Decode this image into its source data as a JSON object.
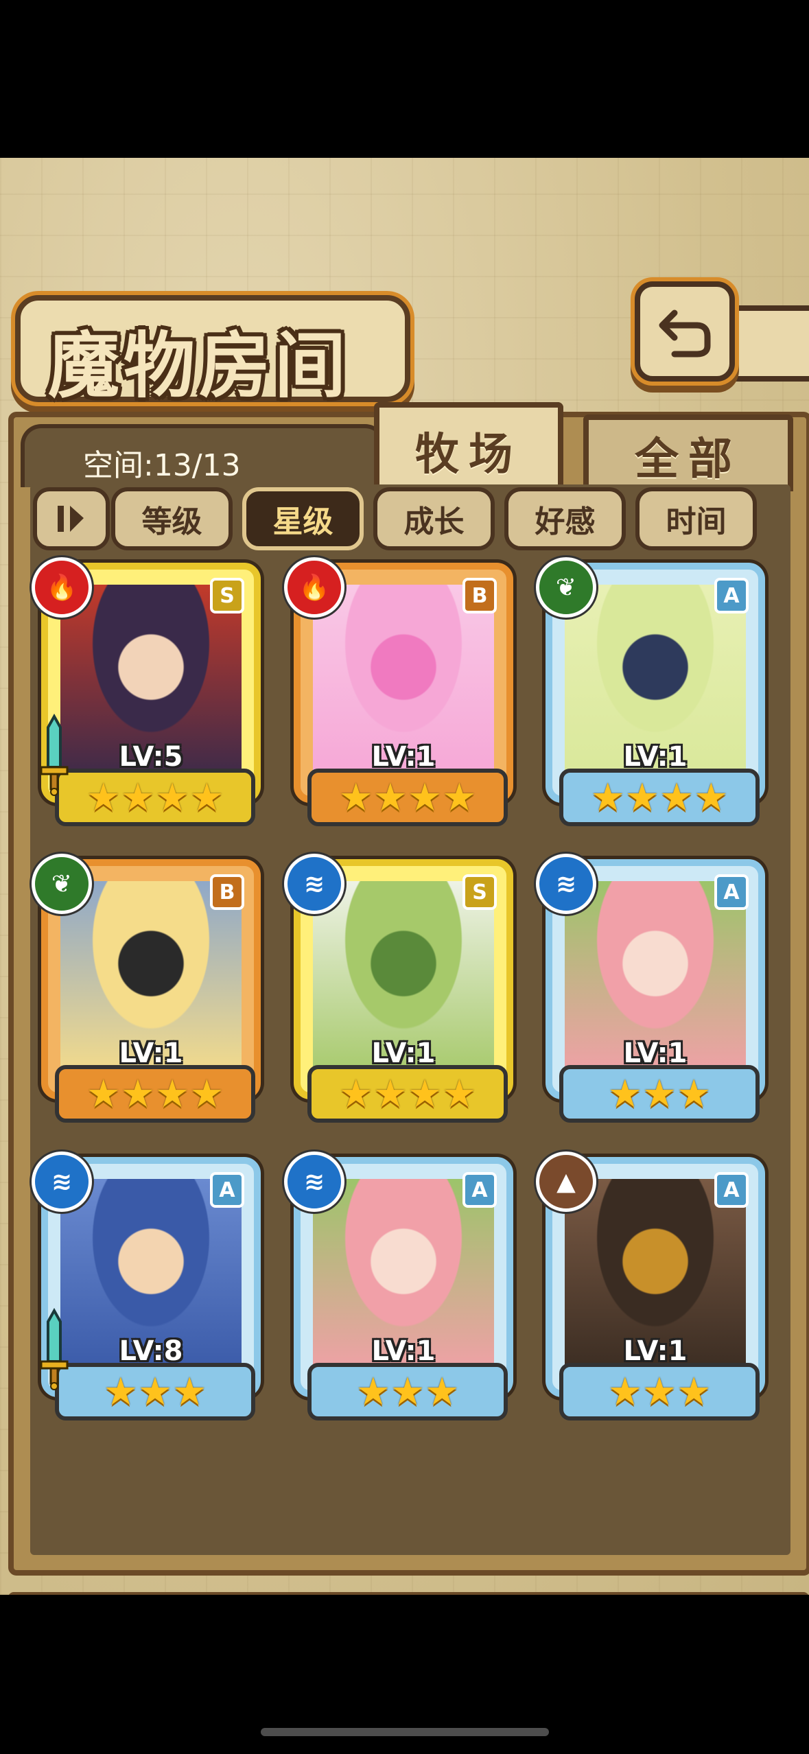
{
  "header": {
    "title": "魔物房间",
    "back_icon": "back-arrow-icon"
  },
  "capacity": {
    "text": "空间:13/13"
  },
  "tabs": [
    {
      "label": "牧场",
      "active": true
    },
    {
      "label": "全部",
      "active": false
    }
  ],
  "sort": {
    "toggle_icon": "sort-order-icon",
    "buttons": [
      {
        "label": "等级",
        "active": false
      },
      {
        "label": "星级",
        "active": true
      },
      {
        "label": "成长",
        "active": false
      },
      {
        "label": "好感",
        "active": false
      },
      {
        "label": "时间",
        "active": false
      }
    ]
  },
  "colors": {
    "frame_gold": "#e8c62a",
    "frame_orange": "#e8902e",
    "frame_blue": "#8cc8e8",
    "element_fire": "#d62020",
    "element_grass": "#2f7a2a",
    "element_water": "#1f72c8",
    "element_earth": "#7a4a2c"
  },
  "monsters": [
    {
      "rank": "S",
      "element": "fire",
      "level": "LV:5",
      "stars": "★★★★",
      "equipped": true
    },
    {
      "rank": "B",
      "element": "fire",
      "level": "LV:1",
      "stars": "★★★★",
      "equipped": false
    },
    {
      "rank": "A",
      "element": "grass",
      "level": "LV:1",
      "stars": "★★★★",
      "equipped": false
    },
    {
      "rank": "B",
      "element": "grass",
      "level": "LV:1",
      "stars": "★★★★",
      "equipped": false
    },
    {
      "rank": "S",
      "element": "water",
      "level": "LV:1",
      "stars": "★★★★",
      "equipped": false
    },
    {
      "rank": "A",
      "element": "water",
      "level": "LV:1",
      "stars": "★★★",
      "equipped": false
    },
    {
      "rank": "A",
      "element": "water",
      "level": "LV:8",
      "stars": "★★★",
      "equipped": true
    },
    {
      "rank": "A",
      "element": "water",
      "level": "LV:1",
      "stars": "★★★",
      "equipped": false
    },
    {
      "rank": "A",
      "element": "earth",
      "level": "LV:1",
      "stars": "★★★",
      "equipped": false
    }
  ]
}
